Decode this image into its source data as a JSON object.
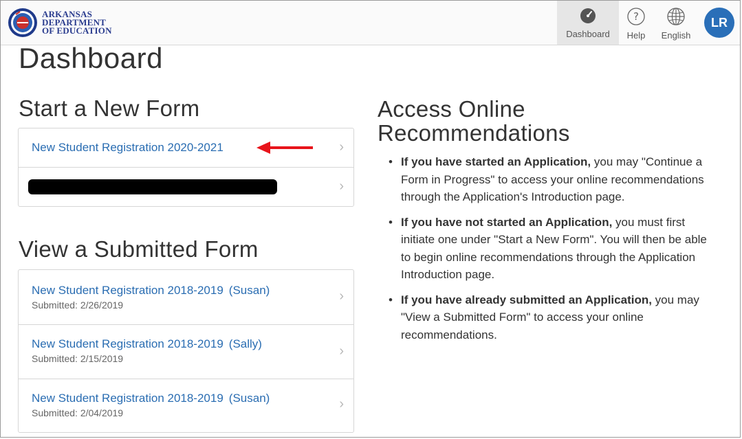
{
  "header": {
    "logo_line1": "ARKANSAS",
    "logo_line2": "DEPARTMENT",
    "logo_line3": "OF EDUCATION",
    "nav": [
      {
        "label": "Dashboard",
        "icon": "dashboard-gauge-icon"
      },
      {
        "label": "Help",
        "icon": "help-question-icon"
      },
      {
        "label": "English",
        "icon": "globe-icon"
      }
    ],
    "avatar_initials": "LR"
  },
  "page_title": "Dashboard",
  "start_section": {
    "title": "Start a New Form",
    "items": [
      {
        "label": "New Student Registration 2020-2021"
      },
      {
        "label": "",
        "redacted": true
      }
    ]
  },
  "submitted_section": {
    "title": "View a Submitted Form",
    "items": [
      {
        "label": "New Student Registration 2018-2019",
        "person": "(Susan)",
        "submitted": "Submitted: 2/26/2019"
      },
      {
        "label": "New Student Registration 2018-2019",
        "person": "(Sally)",
        "submitted": "Submitted: 2/15/2019"
      },
      {
        "label": "New Student Registration 2018-2019",
        "person": "(Susan)",
        "submitted": "Submitted: 2/04/2019"
      }
    ]
  },
  "recommendations": {
    "title_line1": "Access Online",
    "title_line2": "Recommendations",
    "bullets": [
      {
        "bold": "If you have started an Application,",
        "text": " you may \"Continue a Form in Progress\" to access your online recommendations through the Application's Introduction page."
      },
      {
        "bold": "If you have not started an Application,",
        "text": " you must first initiate one under \"Start a New Form\". You will then be able to begin online recommendations through the Application Introduction page."
      },
      {
        "bold": "If you have already submitted an Application,",
        "text": " you may \"View a Submitted Form\" to access your online recommendations."
      }
    ]
  },
  "colors": {
    "link": "#2a6db2",
    "avatar": "#2a6fb8",
    "arrow": "#e8141b"
  }
}
